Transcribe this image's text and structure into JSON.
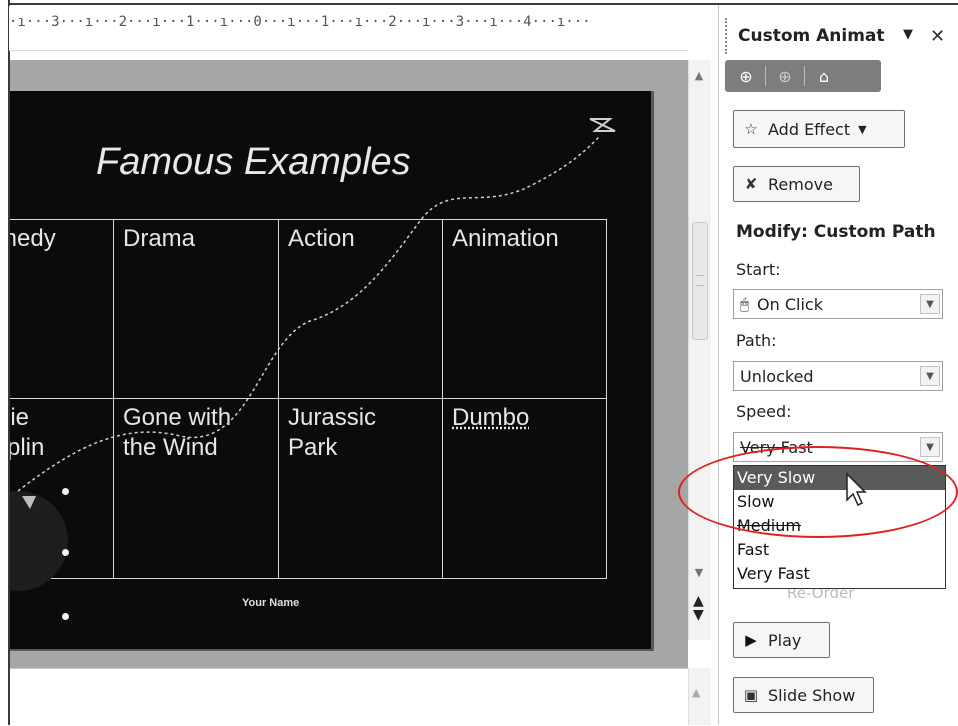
{
  "ruler": {
    "text": "·ı···3···ı···2···ı···1···ı···0···ı···1···ı···2···ı···3···ı···4···ı···"
  },
  "slide": {
    "title": "Famous Examples",
    "table": {
      "row1": [
        "medy",
        "Drama",
        "Action",
        "Animation"
      ],
      "row2": [
        "rlie\nplin",
        "Gone with\nthe Wind",
        "Jurassic\nPark",
        "Dumbo"
      ]
    },
    "footer": "Your Name"
  },
  "pane": {
    "title": "Custom Animat",
    "nav": {
      "back_icon": "back-arrow-icon",
      "forward_icon": "forward-arrow-icon",
      "home_icon": "home-icon"
    },
    "add_effect": "Add Effect",
    "remove": "Remove",
    "modify_heading": "Modify: Custom Path",
    "start_label": "Start:",
    "start_value": "On Click",
    "path_label": "Path:",
    "path_value": "Unlocked",
    "speed_label": "Speed:",
    "speed_value": "Very Fast",
    "speed_options": [
      "Very Slow",
      "Slow",
      "Medium",
      "Fast",
      "Very Fast"
    ],
    "speed_highlighted": "Very Slow",
    "hidden_row_text": "Re-Order",
    "play": "Play",
    "slideshow": "Slide Show"
  },
  "colors": {
    "slide_bg": "#0b0b0b",
    "pane_nav": "#7d7d7d",
    "annotation": "#dd2222",
    "selection": "#5a5a5a"
  }
}
